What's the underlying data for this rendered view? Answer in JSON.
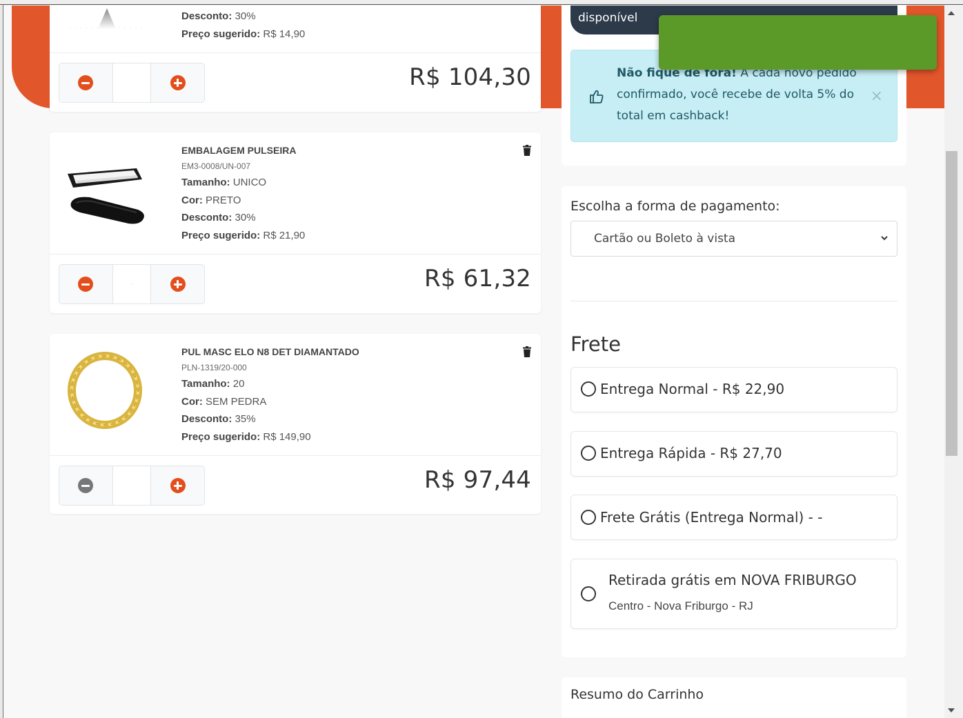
{
  "products": [
    {
      "discount_label": "Desconto:",
      "discount_value": "30%",
      "suggested_label": "Preço sugerido:",
      "suggested_value": "R$ 14,90",
      "quantity": "",
      "price": "R$ 104,30"
    },
    {
      "name": "EMBALAGEM PULSEIRA",
      "sku": "EM3-0008/UN-007",
      "size_label": "Tamanho:",
      "size_value": "UNICO",
      "color_label": "Cor:",
      "color_value": "PRETO",
      "discount_label": "Desconto:",
      "discount_value": "30%",
      "suggested_label": "Preço sugerido:",
      "suggested_value": "R$ 21,90",
      "quantity": "·",
      "price": "R$ 61,32"
    },
    {
      "name": "PUL MASC ELO N8 DET DIAMANTADO",
      "sku": "PLN-1319/20-000",
      "size_label": "Tamanho:",
      "size_value": "20",
      "color_label": "Cor:",
      "color_value": "SEM PEDRA",
      "discount_label": "Desconto:",
      "discount_value": "35%",
      "suggested_label": "Preço sugerido:",
      "suggested_value": "R$ 149,90",
      "quantity": "",
      "price": "R$ 97,44"
    }
  ],
  "availability_tag": "disponível",
  "cashback_alert": {
    "bold": "Não fique de fora!",
    "text": " A cada novo pedido confirmado, você recebe de volta 5% do total em cashback!",
    "close": "×"
  },
  "payment": {
    "label": "Escolha a forma de pagamento:",
    "selected": "Cartão ou Boleto à vista"
  },
  "shipping": {
    "title": "Frete",
    "options": [
      {
        "label": "Entrega Normal - R$ 22,90"
      },
      {
        "label": "Entrega Rápida - R$ 27,70"
      },
      {
        "label": "Frete Grátis (Entrega Normal) - -"
      }
    ],
    "pickup": {
      "title": "Retirada grátis em NOVA FRIBURGO",
      "subtitle": "Centro - Nova Friburgo - RJ"
    }
  },
  "summary_title": "Resumo do Carrinho",
  "colors": {
    "brand_orange": "#e2562b",
    "toast_green": "#5b9a28",
    "alert_bg": "#c8eef5",
    "dark_tag": "#2d3a4a"
  }
}
